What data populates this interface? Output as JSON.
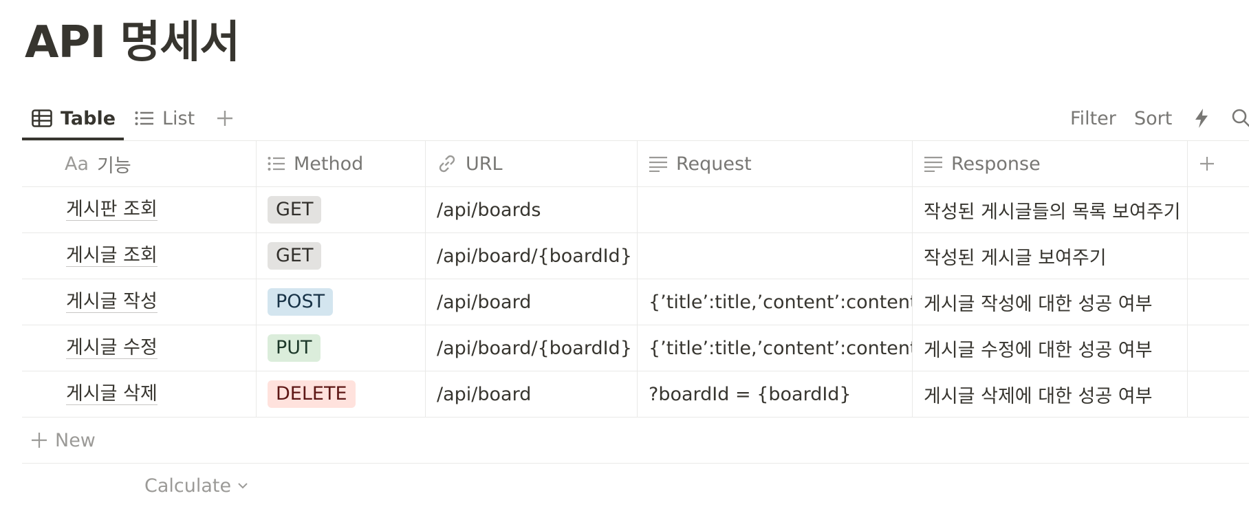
{
  "page": {
    "title": "API 명세서"
  },
  "views": {
    "tabs": [
      {
        "label": "Table",
        "icon": "table-icon",
        "active": true
      },
      {
        "label": "List",
        "icon": "list-icon",
        "active": false
      }
    ],
    "add_icon": "plus-icon"
  },
  "toolbar": {
    "filter": "Filter",
    "sort": "Sort",
    "automation_icon": "lightning-icon",
    "search_icon": "search-icon"
  },
  "table": {
    "columns": [
      {
        "label": "기능",
        "icon": "title-aa-icon"
      },
      {
        "label": "Method",
        "icon": "select-list-icon"
      },
      {
        "label": "URL",
        "icon": "link-icon"
      },
      {
        "label": "Request",
        "icon": "text-lines-icon"
      },
      {
        "label": "Response",
        "icon": "text-lines-icon"
      }
    ],
    "title_prefix": "Aa",
    "rows": [
      {
        "name": "게시판 조회",
        "method": "GET",
        "url": "/api/boards",
        "request": "",
        "response": "작성된 게시글들의 목록 보여주기"
      },
      {
        "name": "게시글 조회",
        "method": "GET",
        "url": "/api/board/{boardId}",
        "request": "",
        "response": "작성된 게시글 보여주기"
      },
      {
        "name": "게시글 작성",
        "method": "POST",
        "url": "/api/board",
        "request": "{’title’:title,’content’:content}",
        "response": "게시글 작성에 대한 성공 여부"
      },
      {
        "name": "게시글 수정",
        "method": "PUT",
        "url": "/api/board/{boardId}",
        "request": "{’title’:title,’content’:content}",
        "response": "게시글 수정에 대한 성공 여부"
      },
      {
        "name": "게시글 삭제",
        "method": "DELETE",
        "url": "/api/board",
        "request": "?boardId = {boardId}",
        "response": "게시글 삭제에 대한 성공 여부"
      }
    ],
    "method_colors": {
      "GET": {
        "bg": "#e3e2e0",
        "fg": "#32302c"
      },
      "POST": {
        "bg": "#d3e5ef",
        "fg": "#183347"
      },
      "PUT": {
        "bg": "#dbeddb",
        "fg": "#1c3829"
      },
      "DELETE": {
        "bg": "#ffe2dd",
        "fg": "#5d1715"
      }
    },
    "new_label": "New",
    "calculate_label": "Calculate"
  }
}
